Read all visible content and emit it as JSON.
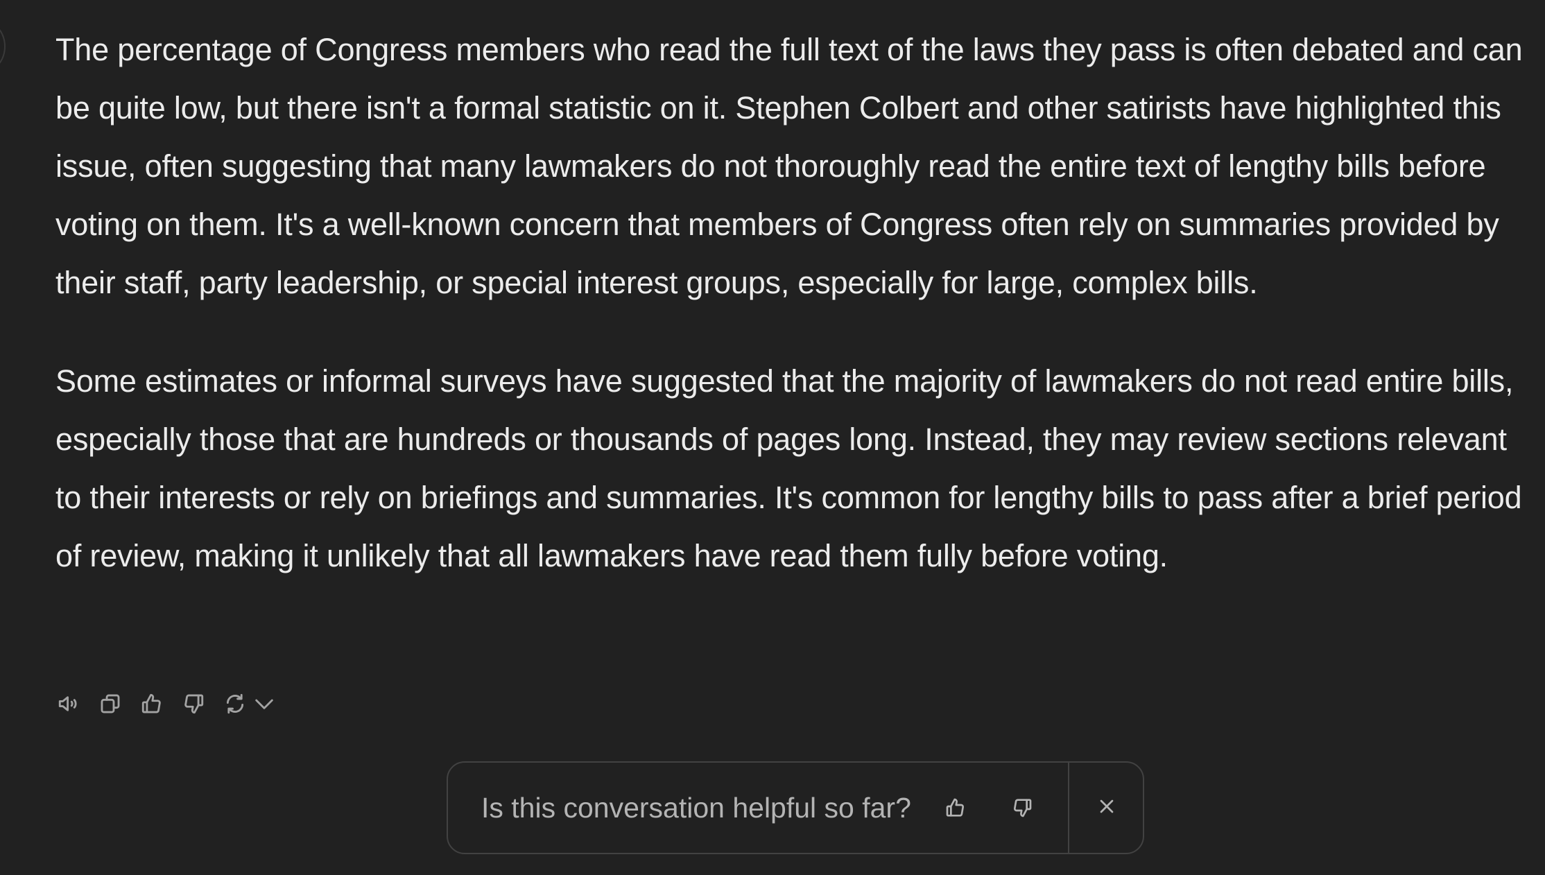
{
  "message": {
    "paragraphs": [
      "The percentage of Congress members who read the full text of the laws they pass is often debated and can be quite low, but there isn't a formal statistic on it. Stephen Colbert and other satirists have highlighted this issue, often suggesting that many lawmakers do not thoroughly read the entire text of lengthy bills before voting on them. It's a well-known concern that members of Congress often rely on summaries provided by their staff, party leadership, or special interest groups, especially for large, complex bills.",
      "Some estimates or informal surveys have suggested that the majority of lawmakers do not read entire bills, especially those that are hundreds or thousands of pages long. Instead, they may review sections relevant to their interests or rely on briefings and summaries. It's common for lengthy bills to pass after a brief period of review, making it unlikely that all lawmakers have read them fully before voting."
    ]
  },
  "actions": {
    "icons": [
      "speaker-icon",
      "copy-icon",
      "thumbs-up-icon",
      "thumbs-down-icon",
      "regenerate-icon",
      "chevron-down-icon"
    ]
  },
  "feedback": {
    "question": "Is this conversation helpful so far?",
    "icons": [
      "thumbs-up-icon",
      "thumbs-down-icon",
      "close-icon"
    ]
  },
  "colors": {
    "background": "#212121",
    "text": "#ececec",
    "muted": "#b4b4b4",
    "border": "#424242"
  }
}
